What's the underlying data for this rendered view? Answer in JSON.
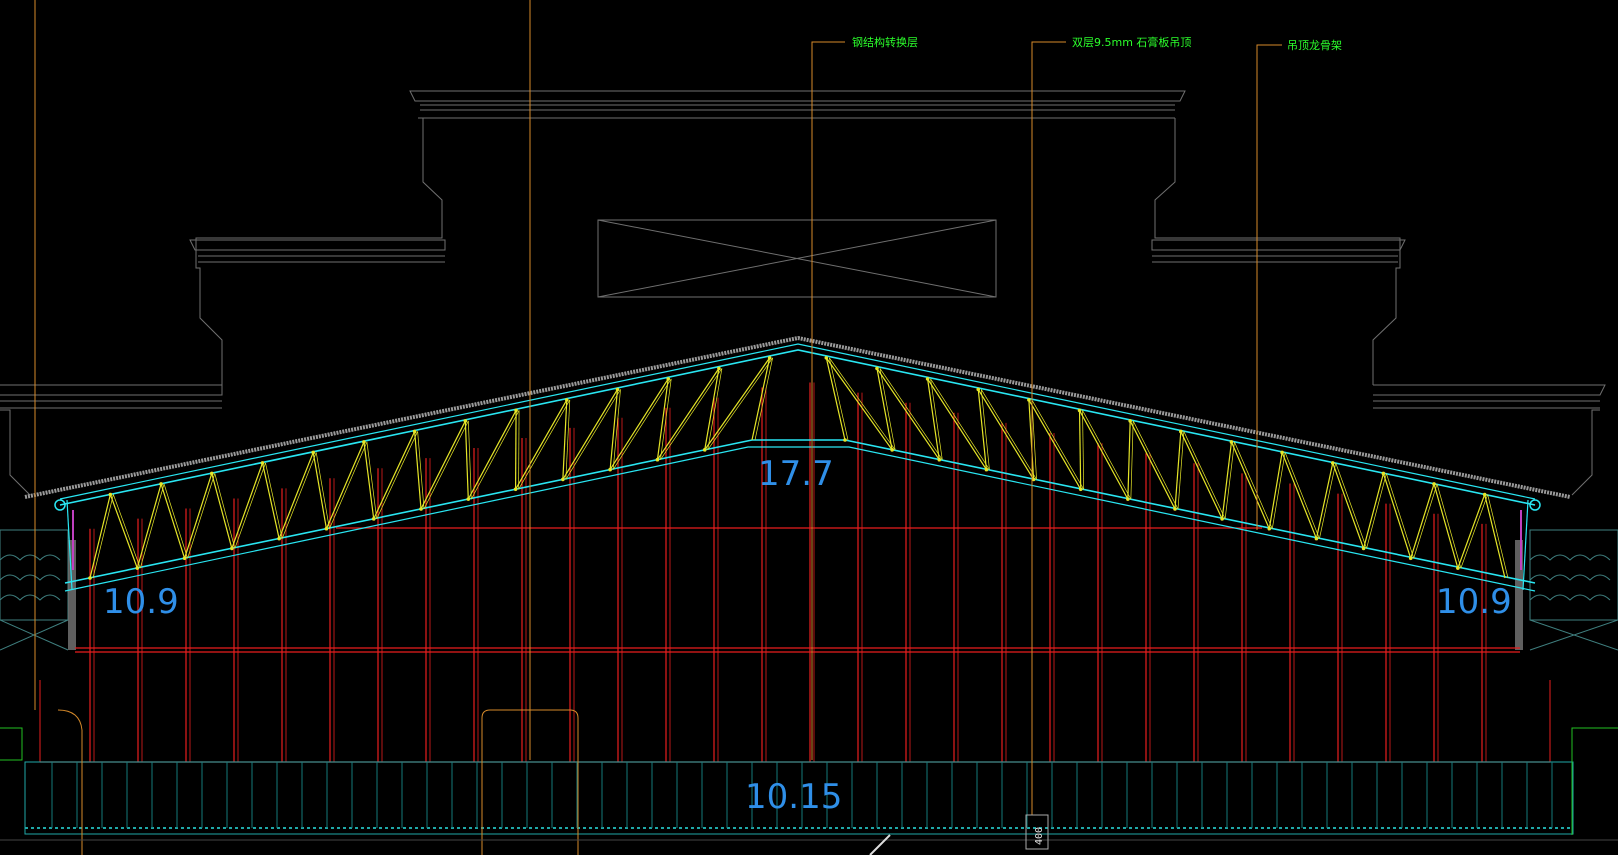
{
  "annotations": {
    "note_1": "钢结构转换层",
    "note_2": "双层9.5mm 石膏板吊顶",
    "note_3": "吊顶龙骨架"
  },
  "dimensions": {
    "left_eave": "10.9",
    "ridge": "17.7",
    "right_eave": "10.9",
    "base": "10.15",
    "small_dim": "400"
  },
  "colors": {
    "truss_chord": "#29e6f2",
    "truss_web": "#e6e628",
    "glass_frame": "#e81e1e",
    "dim_text": "#2f8fe8",
    "leader": "#d68a2a",
    "background_lines": "#7a7a7a",
    "note_text": "#2bff2b"
  }
}
